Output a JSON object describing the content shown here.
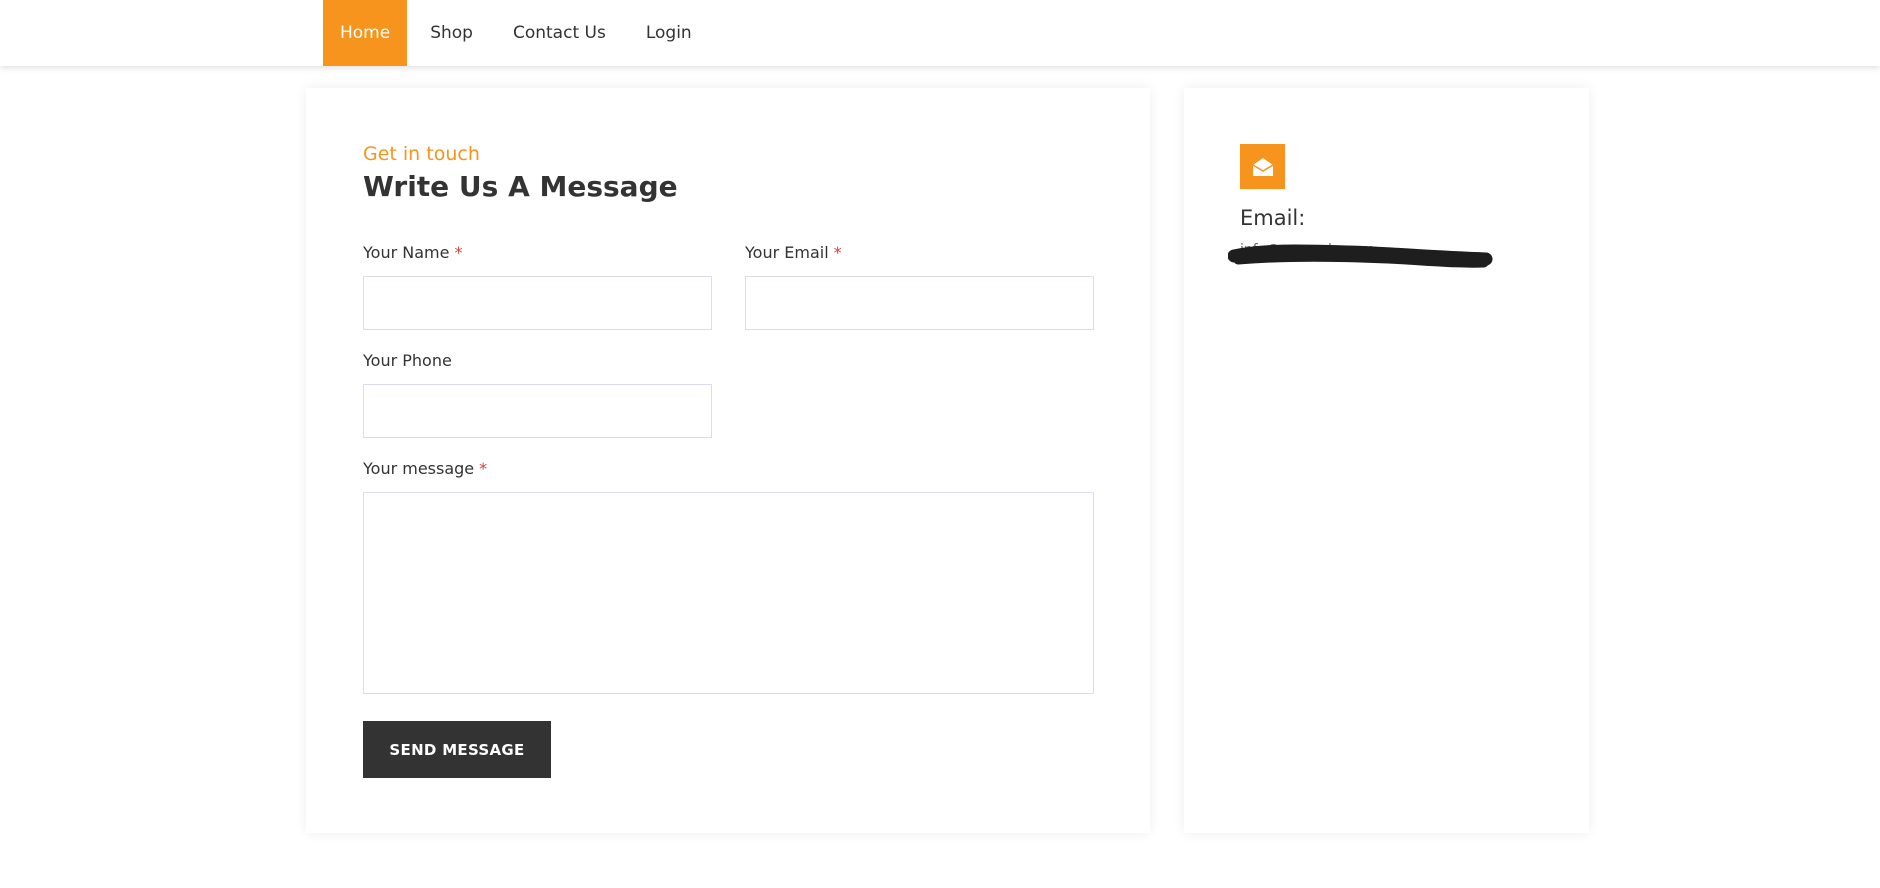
{
  "nav": {
    "items": [
      {
        "label": "Home",
        "active": true
      },
      {
        "label": "Shop",
        "active": false
      },
      {
        "label": "Contact Us",
        "active": false
      },
      {
        "label": "Login",
        "active": false
      }
    ]
  },
  "form": {
    "eyebrow": "Get in touch",
    "title": "Write Us A Message",
    "fields": {
      "name": {
        "label": "Your Name",
        "required_mark": "*",
        "value": "",
        "placeholder": ""
      },
      "email": {
        "label": "Your Email",
        "required_mark": "*",
        "value": "",
        "placeholder": ""
      },
      "phone": {
        "label": "Your Phone",
        "value": "",
        "placeholder": ""
      },
      "message": {
        "label": "Your message",
        "required_mark": "*",
        "value": "",
        "placeholder": ""
      }
    },
    "submit_label": "SEND MESSAGE"
  },
  "info": {
    "icon": "envelope-open-icon",
    "heading": "Email:",
    "email_value": "info@example.com",
    "email_redacted": true
  },
  "colors": {
    "accent": "#f7941d",
    "dark": "#333333",
    "required": "#e53935",
    "input_border": "#dcdcef"
  }
}
